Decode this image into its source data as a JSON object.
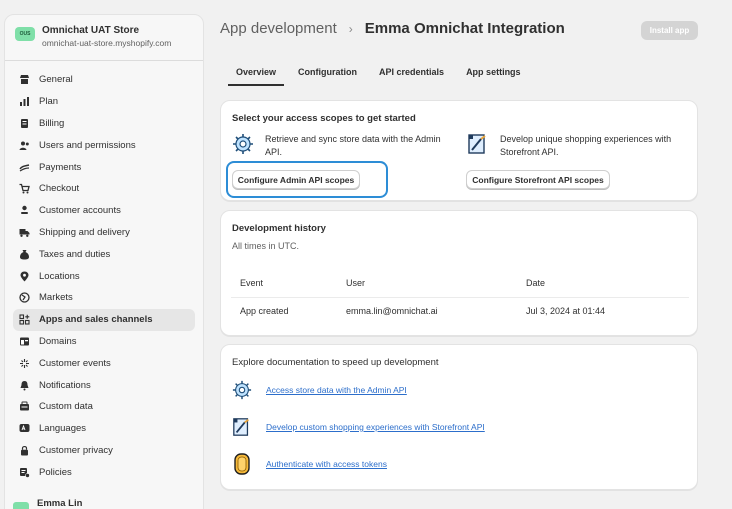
{
  "store": {
    "avatar_text": "OUS",
    "name": "Omnichat UAT Store",
    "domain": "omnichat-uat-store.myshopify.com"
  },
  "sidebar": {
    "items": [
      {
        "label": "General",
        "icon": "store-icon"
      },
      {
        "label": "Plan",
        "icon": "plan-chart-icon"
      },
      {
        "label": "Billing",
        "icon": "billing-icon"
      },
      {
        "label": "Users and permissions",
        "icon": "users-icon"
      },
      {
        "label": "Payments",
        "icon": "payments-icon"
      },
      {
        "label": "Checkout",
        "icon": "cart-icon"
      },
      {
        "label": "Customer accounts",
        "icon": "person-icon"
      },
      {
        "label": "Shipping and delivery",
        "icon": "truck-icon"
      },
      {
        "label": "Taxes and duties",
        "icon": "tax-icon"
      },
      {
        "label": "Locations",
        "icon": "location-pin-icon"
      },
      {
        "label": "Markets",
        "icon": "globe-icon"
      },
      {
        "label": "Apps and sales channels",
        "icon": "apps-icon",
        "active": true
      },
      {
        "label": "Domains",
        "icon": "domains-icon"
      },
      {
        "label": "Customer events",
        "icon": "sparkle-icon"
      },
      {
        "label": "Notifications",
        "icon": "bell-icon"
      },
      {
        "label": "Custom data",
        "icon": "database-icon"
      },
      {
        "label": "Languages",
        "icon": "language-icon"
      },
      {
        "label": "Customer privacy",
        "icon": "lock-icon"
      },
      {
        "label": "Policies",
        "icon": "policies-icon"
      }
    ],
    "user": {
      "name": "Emma Lin"
    }
  },
  "header": {
    "breadcrumb": "App development",
    "separator": "›",
    "title": "Emma Omnichat Integration",
    "install_button": "Install app"
  },
  "tabs": [
    {
      "label": "Overview",
      "active": true
    },
    {
      "label": "Configuration"
    },
    {
      "label": "API credentials"
    },
    {
      "label": "App settings"
    }
  ],
  "scopes_card": {
    "title": "Select your access scopes to get started",
    "admin": {
      "description": "Retrieve and sync store data with the Admin API.",
      "button": "Configure Admin API scopes"
    },
    "storefront": {
      "description": "Develop unique shopping experiences with Storefront API.",
      "button": "Configure Storefront API scopes"
    }
  },
  "history_card": {
    "title": "Development history",
    "subtitle": "All times in UTC.",
    "columns": [
      "Event",
      "User",
      "Date"
    ],
    "rows": [
      {
        "event": "App created",
        "user": "emma.lin@omnichat.ai",
        "date": "Jul 3, 2024 at 01:44"
      }
    ]
  },
  "docs_card": {
    "title": "Explore documentation to speed up development",
    "links": [
      {
        "label": "Access store data with the Admin API",
        "icon": "admin-api-gear-icon"
      },
      {
        "label": "Develop custom shopping experiences with Storefront API",
        "icon": "storefront-api-icon"
      },
      {
        "label": "Authenticate with access tokens",
        "icon": "access-token-icon"
      }
    ]
  },
  "colors": {
    "accent_link": "#2c6ecb",
    "focus_ring": "#2d8dd6",
    "store_avatar": "#7fdfa8"
  }
}
